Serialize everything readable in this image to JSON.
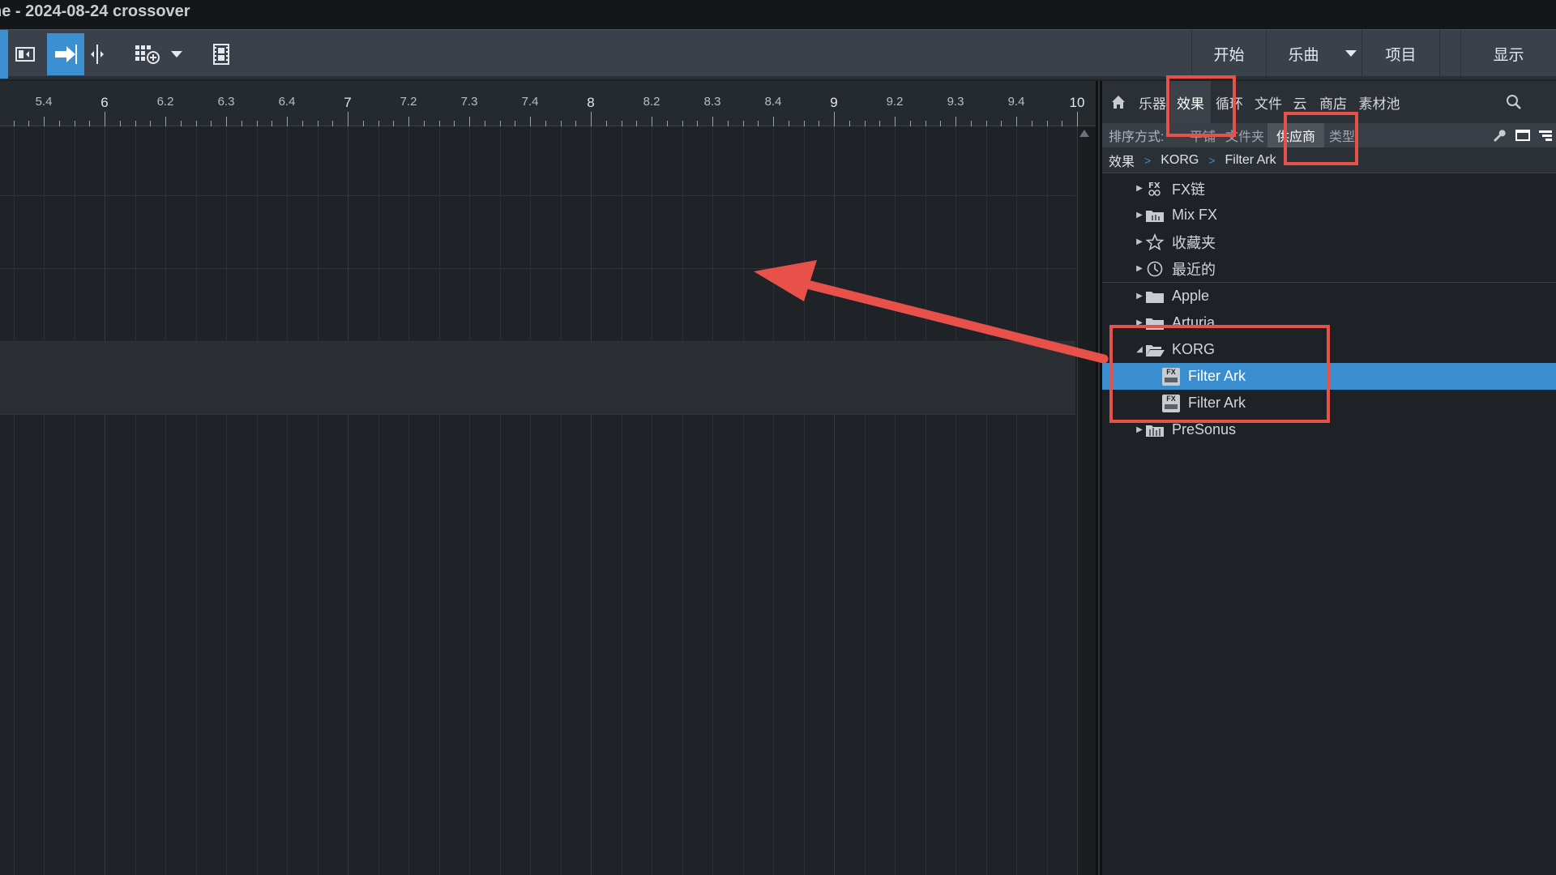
{
  "window": {
    "title": "ne - 2024-08-24 crossover"
  },
  "toolbar": {
    "right_tabs": [
      {
        "label": "开始"
      },
      {
        "label": "乐曲"
      },
      {
        "label": "项目"
      },
      {
        "label": "显示"
      }
    ]
  },
  "ruler": {
    "labels": [
      "5.4",
      "6",
      "6.2",
      "6.3",
      "6.4",
      "7",
      "7.2",
      "7.3",
      "7.4",
      "8",
      "8.2",
      "8.3",
      "8.4",
      "9",
      "9.2",
      "9.3",
      "9.4",
      "10"
    ]
  },
  "browser": {
    "tabs": [
      {
        "label": "乐器"
      },
      {
        "label": "效果"
      },
      {
        "label": "循环"
      },
      {
        "label": "文件"
      },
      {
        "label": "云"
      },
      {
        "label": "商店"
      },
      {
        "label": "素材池"
      }
    ],
    "sort": {
      "label": "排序方式:",
      "options": [
        {
          "label": "平铺"
        },
        {
          "label": "文件夹"
        },
        {
          "label": "供应商"
        },
        {
          "label": "类型"
        }
      ]
    },
    "breadcrumb": [
      "效果",
      "KORG",
      "Filter Ark"
    ],
    "tree": {
      "fx_chain": "FX链",
      "mix_fx": "Mix FX",
      "favorites": "收藏夹",
      "recent": "最近的",
      "apple": "Apple",
      "arturia": "Arturia",
      "korg": "KORG",
      "filter_ark_1": "Filter Ark",
      "filter_ark_2": "Filter Ark",
      "presonus": "PreSonus"
    },
    "fx_badge": "FX"
  },
  "colors": {
    "accent": "#3a8ed0",
    "annotation": "#e8504a"
  }
}
